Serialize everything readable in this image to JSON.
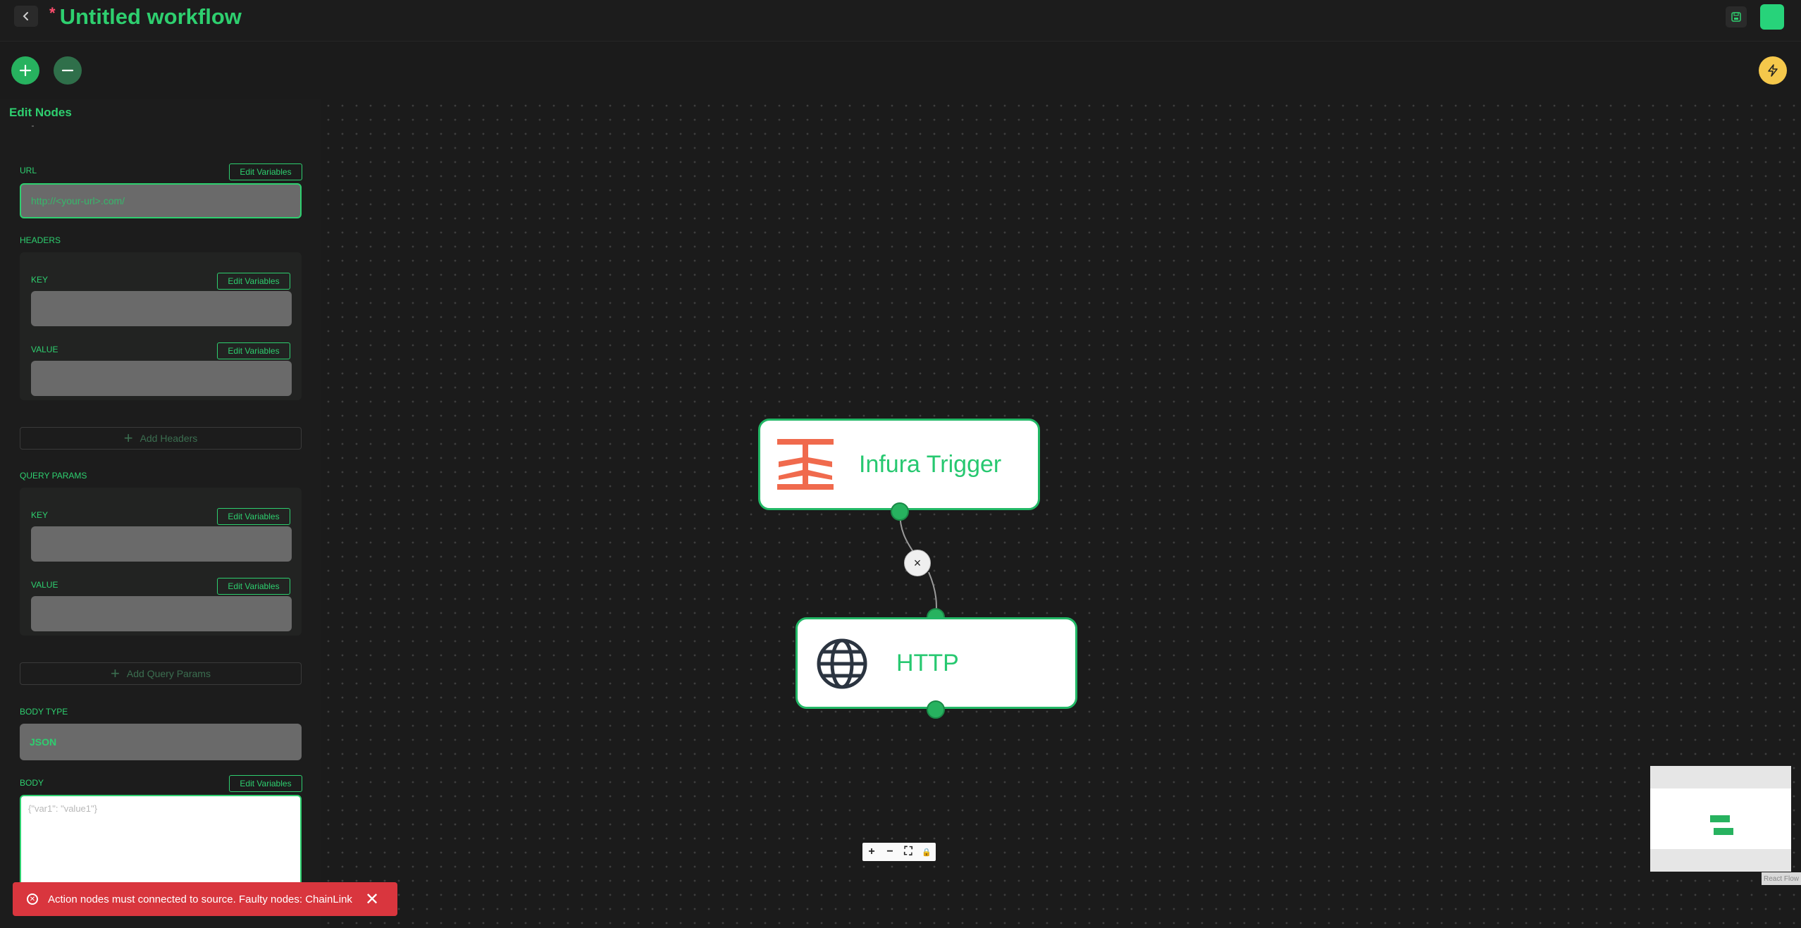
{
  "header": {
    "unsaved_marker": "*",
    "title": "Untitled workflow"
  },
  "icons": {
    "back": "chevron-left-icon",
    "save": "save-icon",
    "zoom_in": "plus-icon",
    "zoom_out": "minus-icon",
    "flash": "lightning-icon"
  },
  "panel": {
    "title": "Edit Nodes",
    "edit_variables_label": "Edit Variables",
    "url": {
      "label": "URL",
      "placeholder": "http://<your-url>.com/"
    },
    "headers": {
      "label": "HEADERS",
      "key_label": "KEY",
      "value_label": "VALUE",
      "add_label": "Add Headers"
    },
    "query_params": {
      "label": "QUERY PARAMS",
      "key_label": "KEY",
      "value_label": "VALUE",
      "add_label": "Add Query Params"
    },
    "body_type": {
      "label": "BODY TYPE",
      "value": "JSON"
    },
    "body": {
      "label": "BODY",
      "placeholder": "{\"var1\": \"value1\"}"
    }
  },
  "nodes": [
    {
      "title": "Infura Trigger",
      "icon": "infura-logo-icon"
    },
    {
      "title": "HTTP",
      "icon": "globe-icon"
    }
  ],
  "edge": {
    "delete_label": "×"
  },
  "controls": [
    "+",
    "−",
    "⛶",
    "🔒"
  ],
  "minimap": {
    "attribution": "React Flow"
  },
  "toast": {
    "message": "Action nodes must connected to source. Faulty nodes: ChainLink",
    "close": "✕"
  },
  "colors": {
    "accent": "#2ecf6f",
    "background": "#1b1b1b",
    "error": "#d9363e",
    "infura": "#f06a4d",
    "flash": "#f5c84b"
  }
}
